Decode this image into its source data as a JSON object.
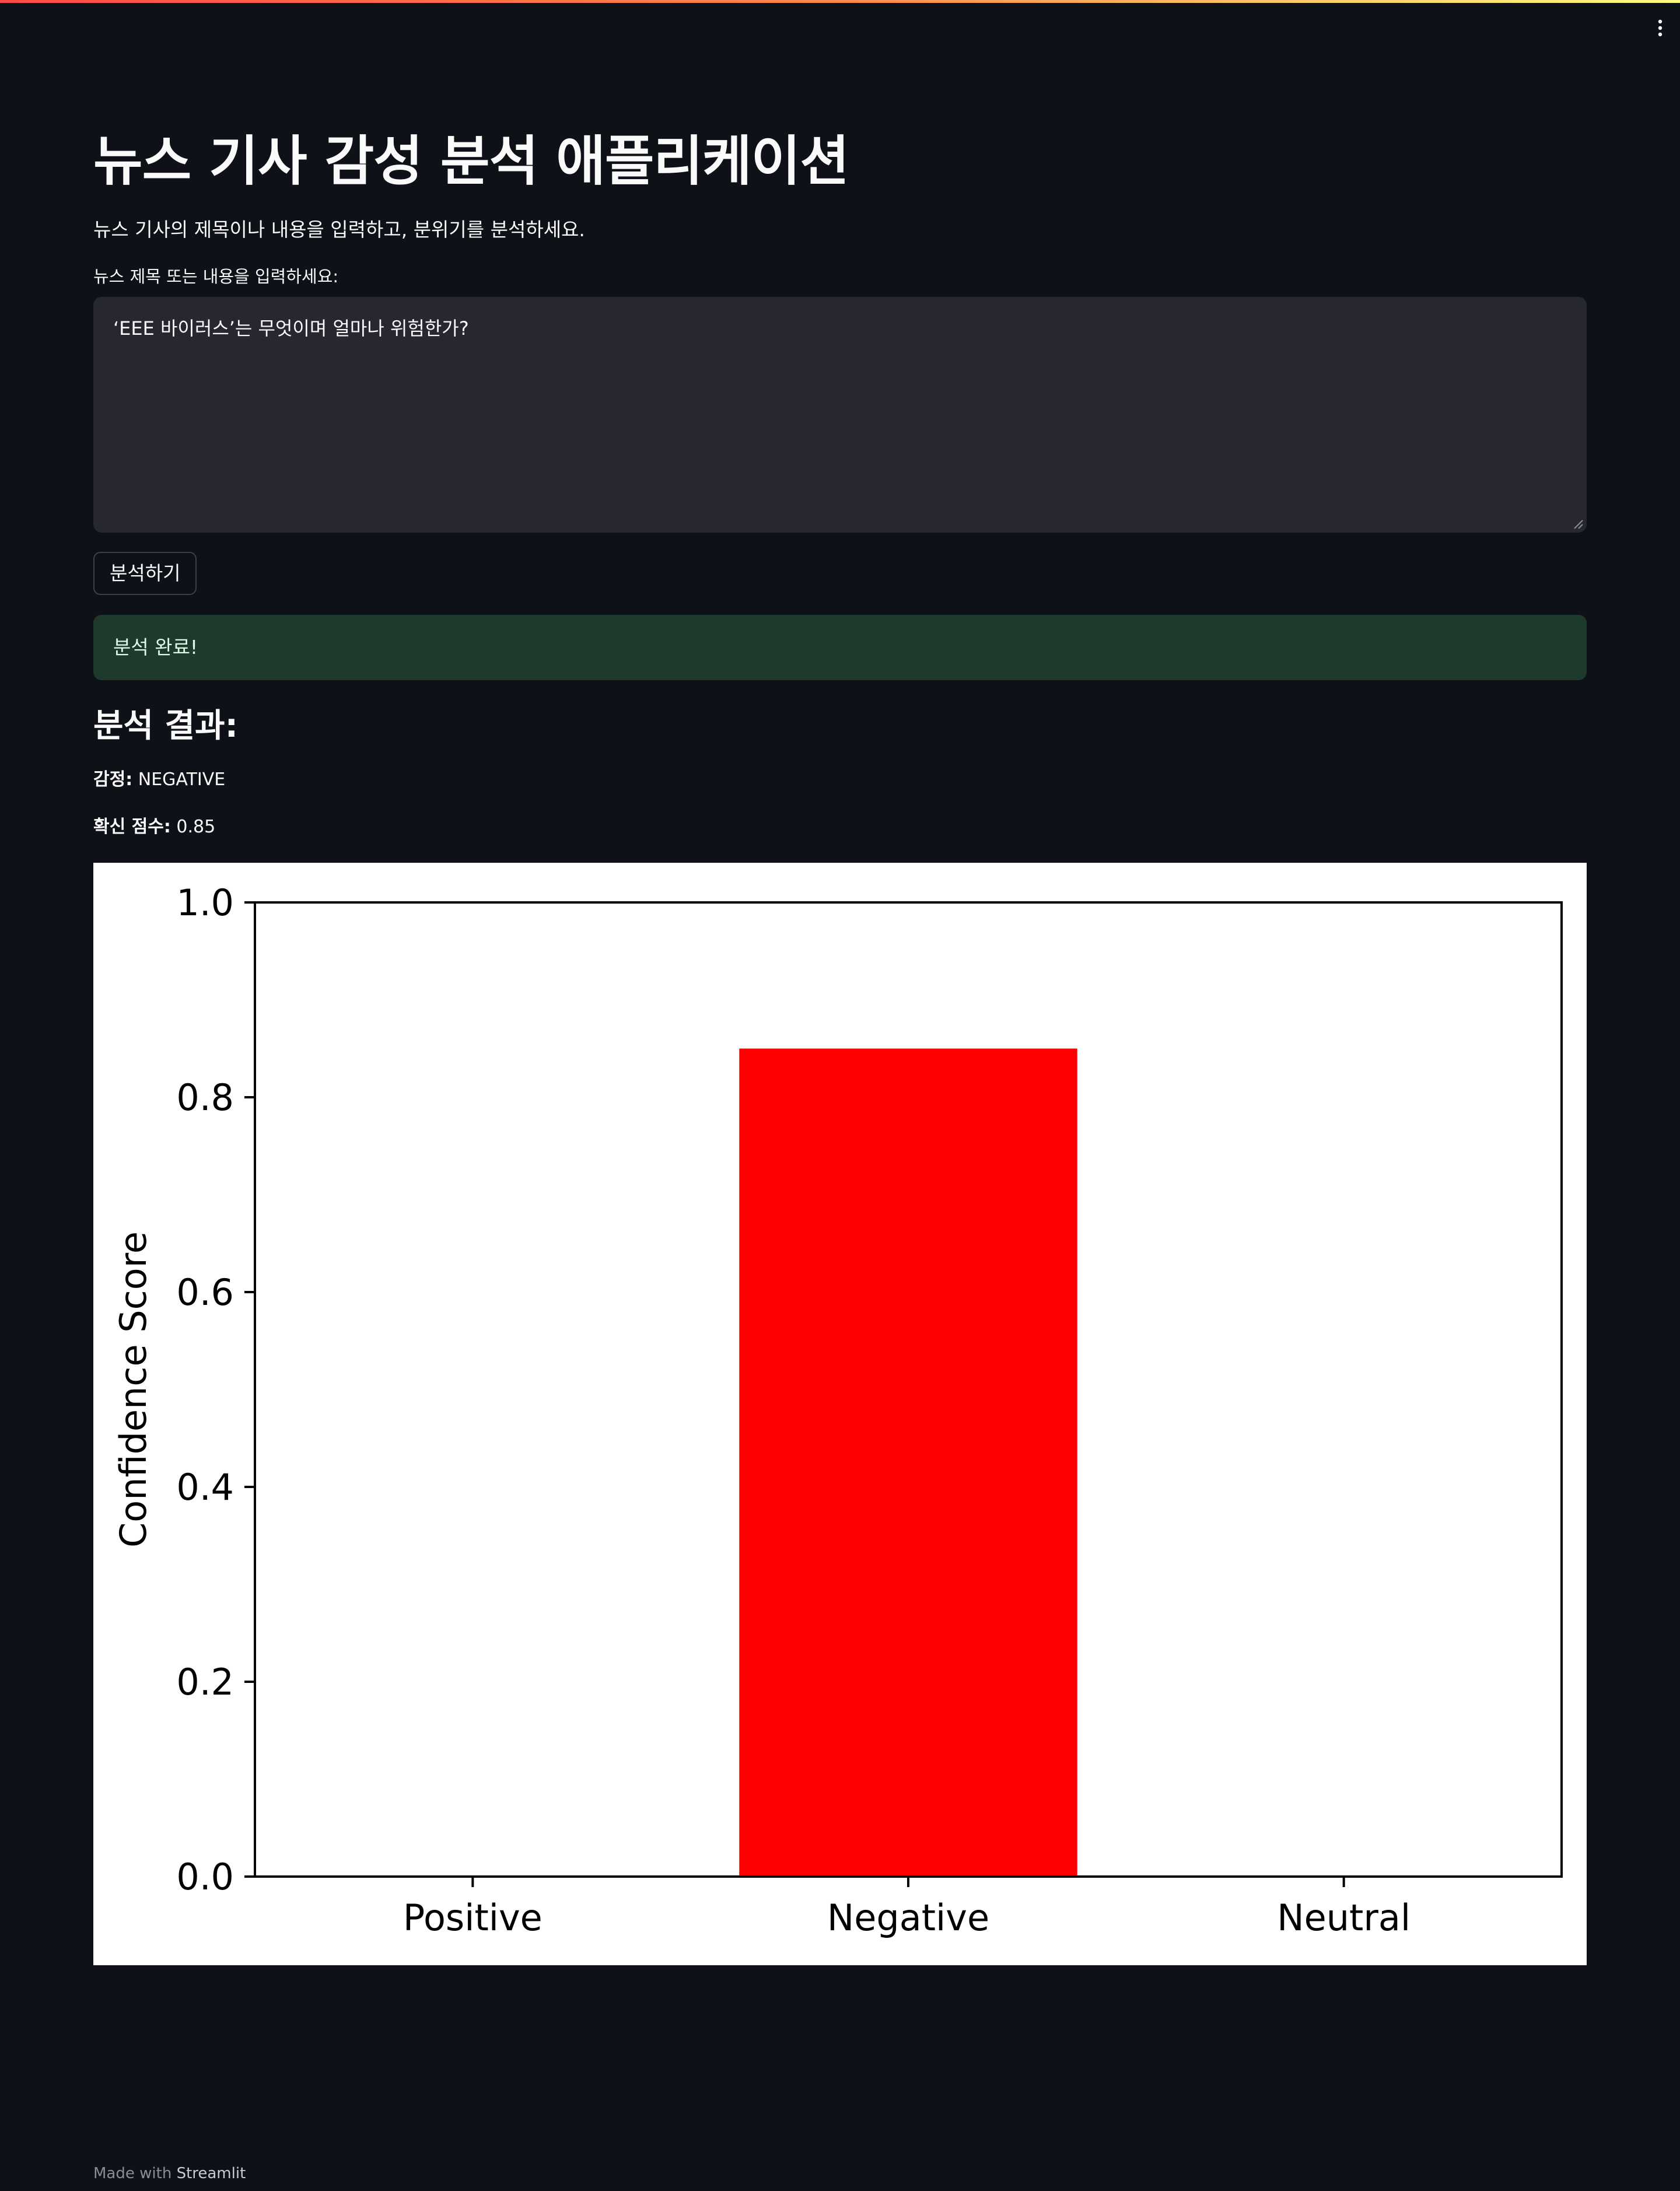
{
  "app": {
    "menu_icon": "kebab-menu-icon"
  },
  "main": {
    "title": "뉴스 기사 감성 분석 애플리케이션",
    "subtitle": "뉴스 기사의 제목이나 내용을 입력하고, 분위기를 분석하세요.",
    "input_label": "뉴스 제목 또는 내용을 입력하세요:",
    "input_value": "‘EEE 바이러스’는 무엇이며 얼마나 위험한가?",
    "analyze_button": "분석하기",
    "success_message": "분석 완료!",
    "result_heading": "분석 결과:",
    "sentiment_label": "감정:",
    "sentiment_value": "NEGATIVE",
    "score_label": "확신 점수:",
    "score_value": "0.85"
  },
  "footer": {
    "made_with": "Made with",
    "brand": "Streamlit"
  },
  "chart_data": {
    "type": "bar",
    "categories": [
      "Positive",
      "Negative",
      "Neutral"
    ],
    "values": [
      0,
      0.85,
      0
    ],
    "bar_color": "#ff0000",
    "ylabel": "Confidence Score",
    "xlabel": "",
    "ylim": [
      0,
      1
    ],
    "yticks": [
      "0.0",
      "0.2",
      "0.4",
      "0.6",
      "0.8",
      "1.0"
    ],
    "grid": false
  },
  "colors": {
    "background": "#0e1117",
    "input_background": "#262730",
    "success_background": "#1e3a2c",
    "text": "#fafafa"
  }
}
